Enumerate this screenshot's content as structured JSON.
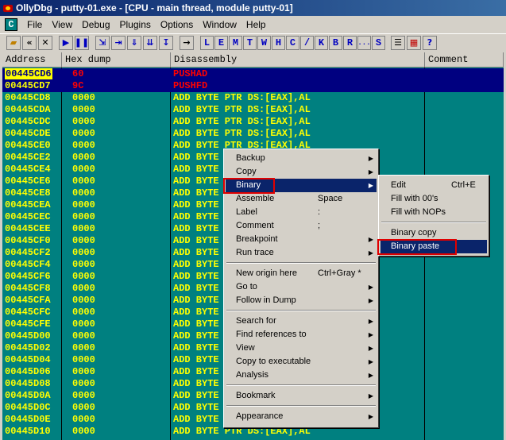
{
  "window": {
    "title": "OllyDbg - putty-01.exe - [CPU - main thread, module putty-01]"
  },
  "menu": {
    "cpu_icon_label": "C",
    "items": [
      "File",
      "View",
      "Debug",
      "Plugins",
      "Options",
      "Window",
      "Help"
    ]
  },
  "toolbar": {
    "buttons": [
      "open-icon",
      "restart-icon",
      "close-icon",
      "run-icon",
      "pause-icon",
      "step-into-icon",
      "step-over-icon",
      "trace-into-icon",
      "trace-over-icon",
      "execute-till-return-icon",
      "goto-icon"
    ],
    "letters": [
      "L",
      "E",
      "M",
      "T",
      "W",
      "H",
      "C",
      "/",
      "K",
      "B",
      "R",
      "...",
      "S"
    ],
    "extra": [
      "list-icon",
      "grid-icon",
      "help-icon"
    ]
  },
  "columns": {
    "address": "Address",
    "hex": "Hex dump",
    "disasm": "Disassembly",
    "comment": "Comment"
  },
  "rows": [
    {
      "addr": "00445CD6",
      "hex": "60",
      "dis": "PUSHAD",
      "selected": true
    },
    {
      "addr": "00445CD7",
      "hex": "9C",
      "dis": "PUSHFD",
      "selected": true
    },
    {
      "addr": "00445CD8",
      "hex": "0000",
      "dis": "ADD BYTE PTR DS:[EAX],AL"
    },
    {
      "addr": "00445CDA",
      "hex": "0000",
      "dis": "ADD BYTE PTR DS:[EAX],AL"
    },
    {
      "addr": "00445CDC",
      "hex": "0000",
      "dis": "ADD BYTE PTR DS:[EAX],AL"
    },
    {
      "addr": "00445CDE",
      "hex": "0000",
      "dis": "ADD BYTE PTR DS:[EAX],AL"
    },
    {
      "addr": "00445CE0",
      "hex": "0000",
      "dis": "ADD BYTE PTR DS:[EAX],AL"
    },
    {
      "addr": "00445CE2",
      "hex": "0000",
      "dis": "ADD BYTE"
    },
    {
      "addr": "00445CE4",
      "hex": "0000",
      "dis": "ADD BYTE"
    },
    {
      "addr": "00445CE6",
      "hex": "0000",
      "dis": "ADD BYTE"
    },
    {
      "addr": "00445CE8",
      "hex": "0000",
      "dis": "ADD BYTE"
    },
    {
      "addr": "00445CEA",
      "hex": "0000",
      "dis": "ADD BYTE"
    },
    {
      "addr": "00445CEC",
      "hex": "0000",
      "dis": "ADD BYTE"
    },
    {
      "addr": "00445CEE",
      "hex": "0000",
      "dis": "ADD BYTE"
    },
    {
      "addr": "00445CF0",
      "hex": "0000",
      "dis": "ADD BYTE"
    },
    {
      "addr": "00445CF2",
      "hex": "0000",
      "dis": "ADD BYTE"
    },
    {
      "addr": "00445CF4",
      "hex": "0000",
      "dis": "ADD BYTE"
    },
    {
      "addr": "00445CF6",
      "hex": "0000",
      "dis": "ADD BYTE"
    },
    {
      "addr": "00445CF8",
      "hex": "0000",
      "dis": "ADD BYTE"
    },
    {
      "addr": "00445CFA",
      "hex": "0000",
      "dis": "ADD BYTE"
    },
    {
      "addr": "00445CFC",
      "hex": "0000",
      "dis": "ADD BYTE"
    },
    {
      "addr": "00445CFE",
      "hex": "0000",
      "dis": "ADD BYTE"
    },
    {
      "addr": "00445D00",
      "hex": "0000",
      "dis": "ADD BYTE"
    },
    {
      "addr": "00445D02",
      "hex": "0000",
      "dis": "ADD BYTE"
    },
    {
      "addr": "00445D04",
      "hex": "0000",
      "dis": "ADD BYTE"
    },
    {
      "addr": "00445D06",
      "hex": "0000",
      "dis": "ADD BYTE"
    },
    {
      "addr": "00445D08",
      "hex": "0000",
      "dis": "ADD BYTE"
    },
    {
      "addr": "00445D0A",
      "hex": "0000",
      "dis": "ADD BYTE"
    },
    {
      "addr": "00445D0C",
      "hex": "0000",
      "dis": "ADD BYTE"
    },
    {
      "addr": "00445D0E",
      "hex": "0000",
      "dis": "ADD BYTE"
    },
    {
      "addr": "00445D10",
      "hex": "0000",
      "dis": "ADD BYTE PTR DS:[EAX],AL"
    }
  ],
  "context_menu": [
    {
      "label": "Backup",
      "shortcut": "",
      "submenu": true
    },
    {
      "label": "Copy",
      "shortcut": "",
      "submenu": true
    },
    {
      "label": "Binary",
      "shortcut": "",
      "submenu": true,
      "highlighted": true
    },
    {
      "label": "Assemble",
      "shortcut": "Space"
    },
    {
      "label": "Label",
      "shortcut": ":"
    },
    {
      "label": "Comment",
      "shortcut": ";"
    },
    {
      "label": "Breakpoint",
      "shortcut": "",
      "submenu": true
    },
    {
      "label": "Run trace",
      "shortcut": "",
      "submenu": true
    },
    {
      "sep": true
    },
    {
      "label": "New origin here",
      "shortcut": "Ctrl+Gray *"
    },
    {
      "label": "Go to",
      "shortcut": "",
      "submenu": true
    },
    {
      "label": "Follow in Dump",
      "shortcut": "",
      "submenu": true
    },
    {
      "sep": true
    },
    {
      "label": "Search for",
      "shortcut": "",
      "submenu": true
    },
    {
      "label": "Find references to",
      "shortcut": "",
      "submenu": true
    },
    {
      "label": "View",
      "shortcut": "",
      "submenu": true
    },
    {
      "label": "Copy to executable",
      "shortcut": "",
      "submenu": true
    },
    {
      "label": "Analysis",
      "shortcut": "",
      "submenu": true
    },
    {
      "sep": true
    },
    {
      "label": "Bookmark",
      "shortcut": "",
      "submenu": true
    },
    {
      "sep": true
    },
    {
      "label": "Appearance",
      "shortcut": "",
      "submenu": true
    }
  ],
  "binary_submenu": [
    {
      "label": "Edit",
      "shortcut": "Ctrl+E"
    },
    {
      "label": "Fill with 00's",
      "shortcut": ""
    },
    {
      "label": "Fill with NOPs",
      "shortcut": ""
    },
    {
      "sep": true
    },
    {
      "label": "Binary copy",
      "shortcut": ""
    },
    {
      "label": "Binary paste",
      "shortcut": "",
      "highlighted": true
    }
  ],
  "colors": {
    "background": "#008080",
    "text": "#ffff00",
    "selected_row": "#000080",
    "selected_text": "#ff0000",
    "menu_highlight": "#0a246a",
    "annotation_box": "#e00000"
  }
}
